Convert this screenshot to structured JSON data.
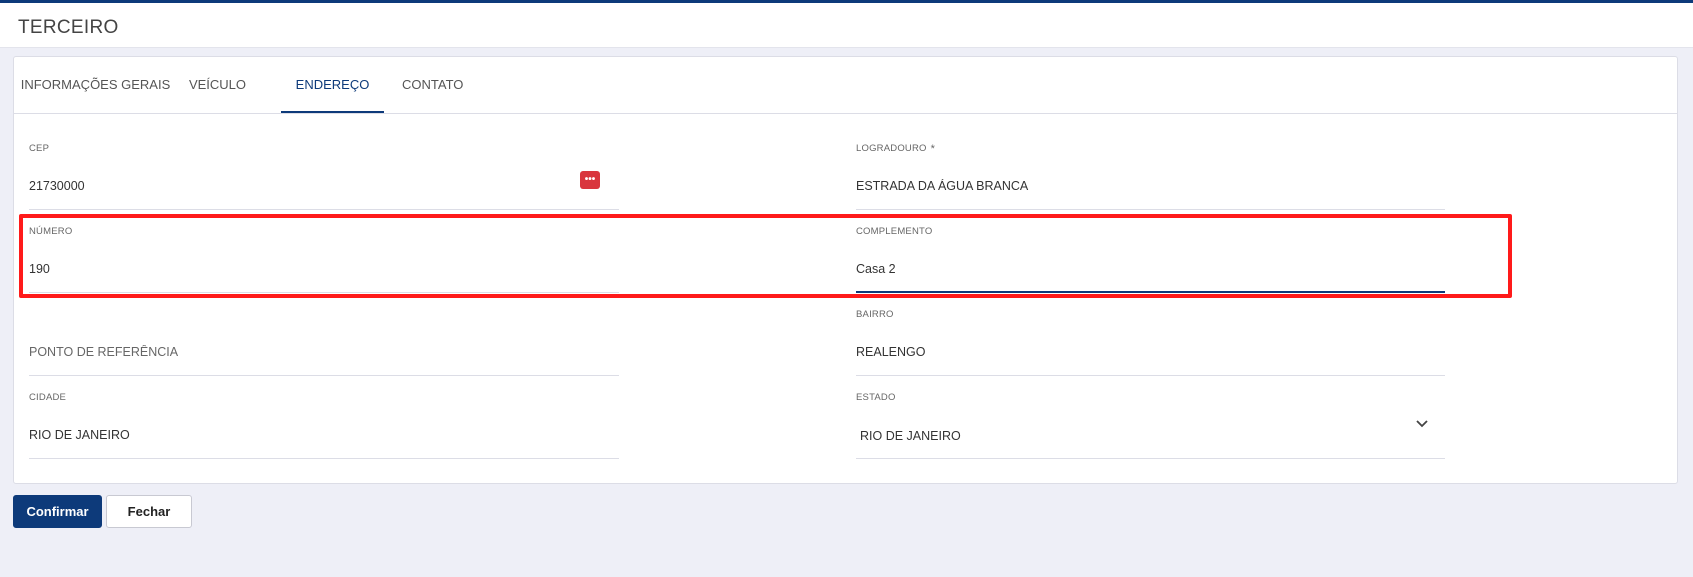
{
  "header": {
    "title": "TERCEIRO"
  },
  "tabs": [
    {
      "label": "INFORMAÇÕES GERAIS",
      "active": false
    },
    {
      "label": "VEÍCULO",
      "active": false
    },
    {
      "label": "ENDEREÇO",
      "active": true
    },
    {
      "label": "CONTATO",
      "active": false
    }
  ],
  "form": {
    "cep": {
      "label": "CEP",
      "value": "21730000",
      "action_icon": "ellipsis-icon"
    },
    "logradouro": {
      "label": "LOGRADOURO",
      "required_mark": "*",
      "value": "ESTRADA DA ÁGUA BRANCA"
    },
    "numero": {
      "label": "NÚMERO",
      "value": "190"
    },
    "complemento": {
      "label": "COMPLEMENTO",
      "value": "Casa 2",
      "focused": true
    },
    "ponto_referencia": {
      "placeholder": "PONTO DE REFERÊNCIA",
      "value": ""
    },
    "bairro": {
      "label": "BAIRRO",
      "value": "REALENGO"
    },
    "cidade": {
      "label": "CIDADE",
      "value": "RIO DE JANEIRO"
    },
    "estado": {
      "label": "ESTADO",
      "value": "RIO DE JANEIRO",
      "icon": "chevron-down-icon"
    }
  },
  "actions": {
    "confirm_label": "Confirmar",
    "close_label": "Fechar"
  },
  "colors": {
    "accent": "#0d3a7a",
    "highlight": "#ff1a1a",
    "cep_button": "#d9363e",
    "background": "#eeeff7"
  }
}
